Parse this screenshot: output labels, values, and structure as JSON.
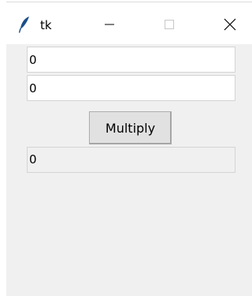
{
  "window": {
    "title": "tk",
    "controls": {
      "minimize": "minimize-icon",
      "maximize": "maximize-icon",
      "close": "close-icon"
    }
  },
  "form": {
    "input_a": "0",
    "input_b": "0",
    "multiply_label": "Multiply",
    "result": "0"
  },
  "colors": {
    "client_background": "#f0f0f0",
    "button_background": "#e1e1e1",
    "entry_border": "#d4d4d4"
  }
}
